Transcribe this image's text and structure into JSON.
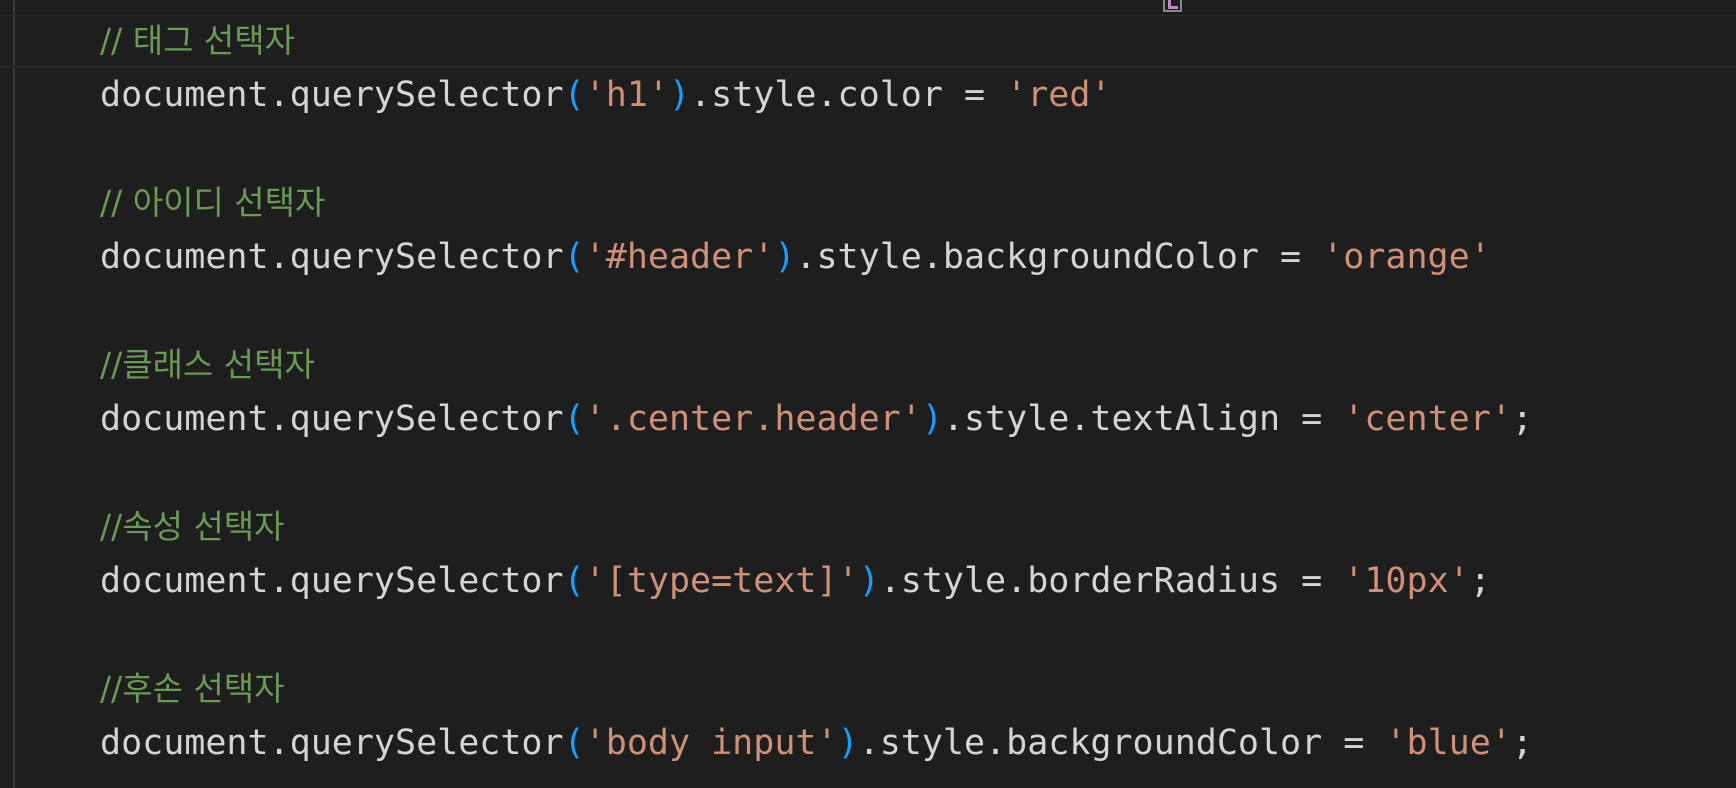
{
  "editor": {
    "colors": {
      "background": "#1e1e1e",
      "comment": "#6a9955",
      "string": "#ce9178",
      "bracket": "#179fff",
      "text": "#d4d4d4"
    },
    "blocks": [
      {
        "comment": "// 태그 선택자",
        "code": {
          "prefix": "document.querySelector",
          "open": "(",
          "selector": "'h1'",
          "close": ")",
          "middle": ".style.color = ",
          "value": "'red'",
          "end": ""
        }
      },
      {
        "comment": "// 아이디 선택자",
        "code": {
          "prefix": "document.querySelector",
          "open": "(",
          "selector": "'#header'",
          "close": ")",
          "middle": ".style.backgroundColor = ",
          "value": "'orange'",
          "end": ""
        }
      },
      {
        "comment": "//클래스 선택자",
        "code": {
          "prefix": "document.querySelector",
          "open": "(",
          "selector": "'.center.header'",
          "close": ")",
          "middle": ".style.textAlign = ",
          "value": "'center'",
          "end": ";"
        }
      },
      {
        "comment": "//속성 선택자",
        "code": {
          "prefix": "document.querySelector",
          "open": "(",
          "selector": "'[type=text]'",
          "close": ")",
          "middle": ".style.borderRadius = ",
          "value": "'10px'",
          "end": ";"
        }
      },
      {
        "comment": "//후손 선택자",
        "code": {
          "prefix": "document.querySelector",
          "open": "(",
          "selector": "'body input'",
          "close": ")",
          "middle": ".style.backgroundColor = ",
          "value": "'blue'",
          "end": ";"
        }
      }
    ]
  }
}
